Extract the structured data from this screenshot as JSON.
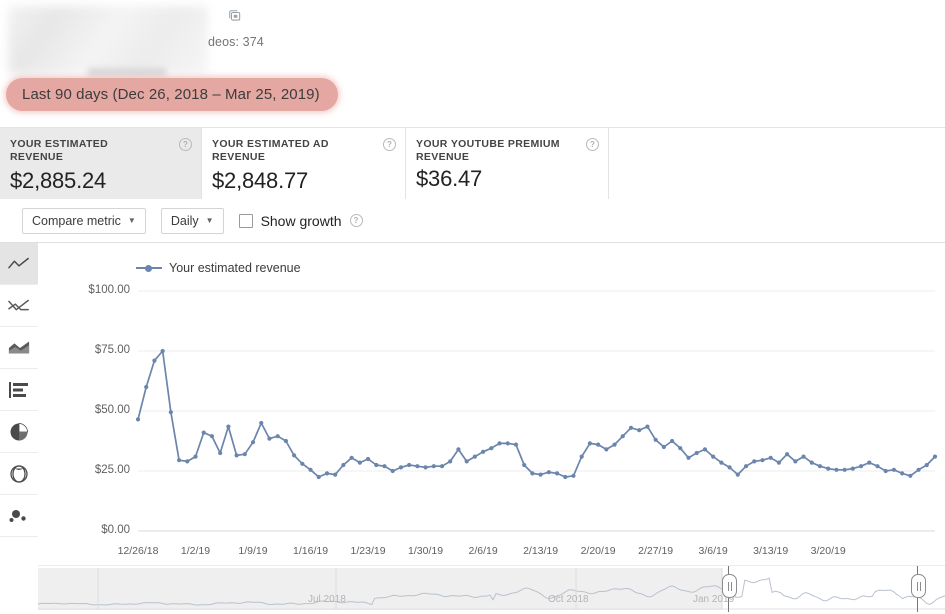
{
  "header": {
    "video_count_label": "deos: 374",
    "video_icon": "video-library-icon",
    "date_range": "Last 90 days (Dec 26, 2018 – Mar 25, 2019)",
    "highlight_color": "#e5a7a1"
  },
  "cards": [
    {
      "label": "YOUR ESTIMATED REVENUE",
      "value": "$2,885.24",
      "selected": true,
      "help": "?"
    },
    {
      "label": "YOUR ESTIMATED AD REVENUE",
      "value": "$2,848.77",
      "selected": false,
      "help": "?"
    },
    {
      "label": "YOUR YOUTUBE PREMIUM REVENUE",
      "value": "$36.47",
      "selected": false,
      "help": "?"
    }
  ],
  "toolbar": {
    "compare_metric_label": "Compare metric",
    "interval_label": "Daily",
    "show_growth_label": "Show growth",
    "show_growth_checked": false,
    "caret": "▼",
    "help": "?"
  },
  "rail": [
    {
      "name": "line-chart-icon",
      "active": true
    },
    {
      "name": "multi-line-chart-icon",
      "active": false
    },
    {
      "name": "area-chart-icon",
      "active": false
    },
    {
      "name": "bar-chart-icon",
      "active": false
    },
    {
      "name": "pie-chart-icon",
      "active": false
    },
    {
      "name": "geography-globe-icon",
      "active": false
    },
    {
      "name": "bubble-chart-icon",
      "active": false
    }
  ],
  "chart_data": {
    "type": "line",
    "title": "",
    "legend": [
      "Your estimated revenue"
    ],
    "legend_position": "top-left",
    "series_color": "#6b85ad",
    "xlabel": "",
    "ylabel": "",
    "ylim": [
      0,
      100
    ],
    "yticks": [
      0,
      25,
      50,
      75,
      100
    ],
    "ytick_labels": [
      "$0.00",
      "$25.00",
      "$50.00",
      "$75.00",
      "$100.00"
    ],
    "grid": true,
    "xtick_labels": [
      "12/26/18",
      "1/2/19",
      "1/9/19",
      "1/16/19",
      "1/23/19",
      "1/30/19",
      "2/6/19",
      "2/13/19",
      "2/20/19",
      "2/27/19",
      "3/6/19",
      "3/13/19",
      "3/20/19"
    ],
    "xtick_indices": [
      0,
      7,
      14,
      21,
      28,
      35,
      42,
      49,
      56,
      63,
      70,
      77,
      84
    ],
    "x_start": "12/26/18",
    "x_end": "3/25/19",
    "series": [
      {
        "name": "Your estimated revenue",
        "values": [
          46.5,
          60.0,
          71.0,
          75.0,
          49.5,
          29.5,
          29.0,
          31.0,
          41.0,
          39.5,
          32.5,
          43.5,
          31.5,
          32.0,
          37.0,
          45.0,
          38.5,
          39.5,
          37.5,
          31.5,
          28.0,
          25.5,
          22.5,
          24.0,
          23.5,
          27.5,
          30.5,
          28.5,
          30.0,
          27.5,
          27.0,
          25.0,
          26.5,
          27.5,
          27.0,
          26.5,
          27.0,
          27.0,
          29.0,
          34.0,
          29.0,
          31.0,
          33.0,
          34.5,
          36.5,
          36.5,
          36.0,
          27.5,
          24.0,
          23.5,
          24.5,
          24.0,
          22.5,
          23.0,
          31.0,
          36.5,
          36.0,
          34.0,
          36.0,
          39.5,
          43.0,
          42.0,
          43.5,
          38.0,
          35.0,
          37.5,
          34.5,
          30.5,
          32.5,
          34.0,
          31.0,
          28.5,
          26.5,
          23.5,
          27.0,
          29.0,
          29.5,
          30.5,
          28.5,
          32.0,
          29.0,
          31.0,
          28.5,
          27.0,
          26.0,
          25.5,
          25.5,
          26.0,
          27.0,
          28.5,
          27.0,
          25.0,
          25.5,
          24.0,
          23.0,
          25.5,
          27.5,
          31.0
        ]
      }
    ]
  },
  "navigator": {
    "labels": [
      "Jul 2018",
      "Oct 2018",
      "Jan 2019"
    ],
    "left_handle_label": "range-start-handle",
    "right_handle_label": "range-end-handle"
  }
}
